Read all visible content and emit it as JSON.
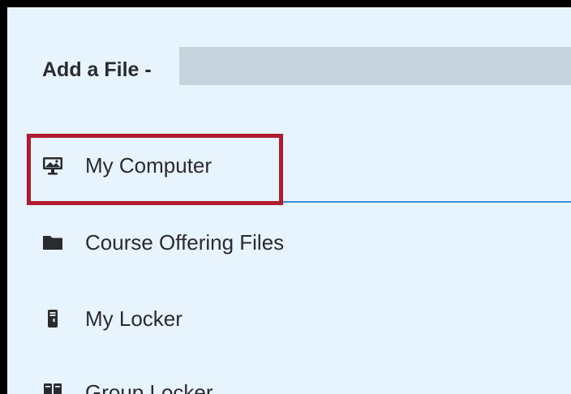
{
  "dialog": {
    "title": "Add a File -"
  },
  "sources": [
    {
      "label": "My Computer",
      "icon": "monitor-icon"
    },
    {
      "label": "Course Offering Files",
      "icon": "folder-icon"
    },
    {
      "label": "My Locker",
      "icon": "locker-icon"
    },
    {
      "label": "Group Locker",
      "icon": "group-locker-icon"
    }
  ],
  "colors": {
    "background": "#e8f4fd",
    "text": "#2a2b2e",
    "highlight_border": "#b01c2e",
    "tab_underline": "#3a8dd8",
    "redaction": "#c6d3dc"
  }
}
